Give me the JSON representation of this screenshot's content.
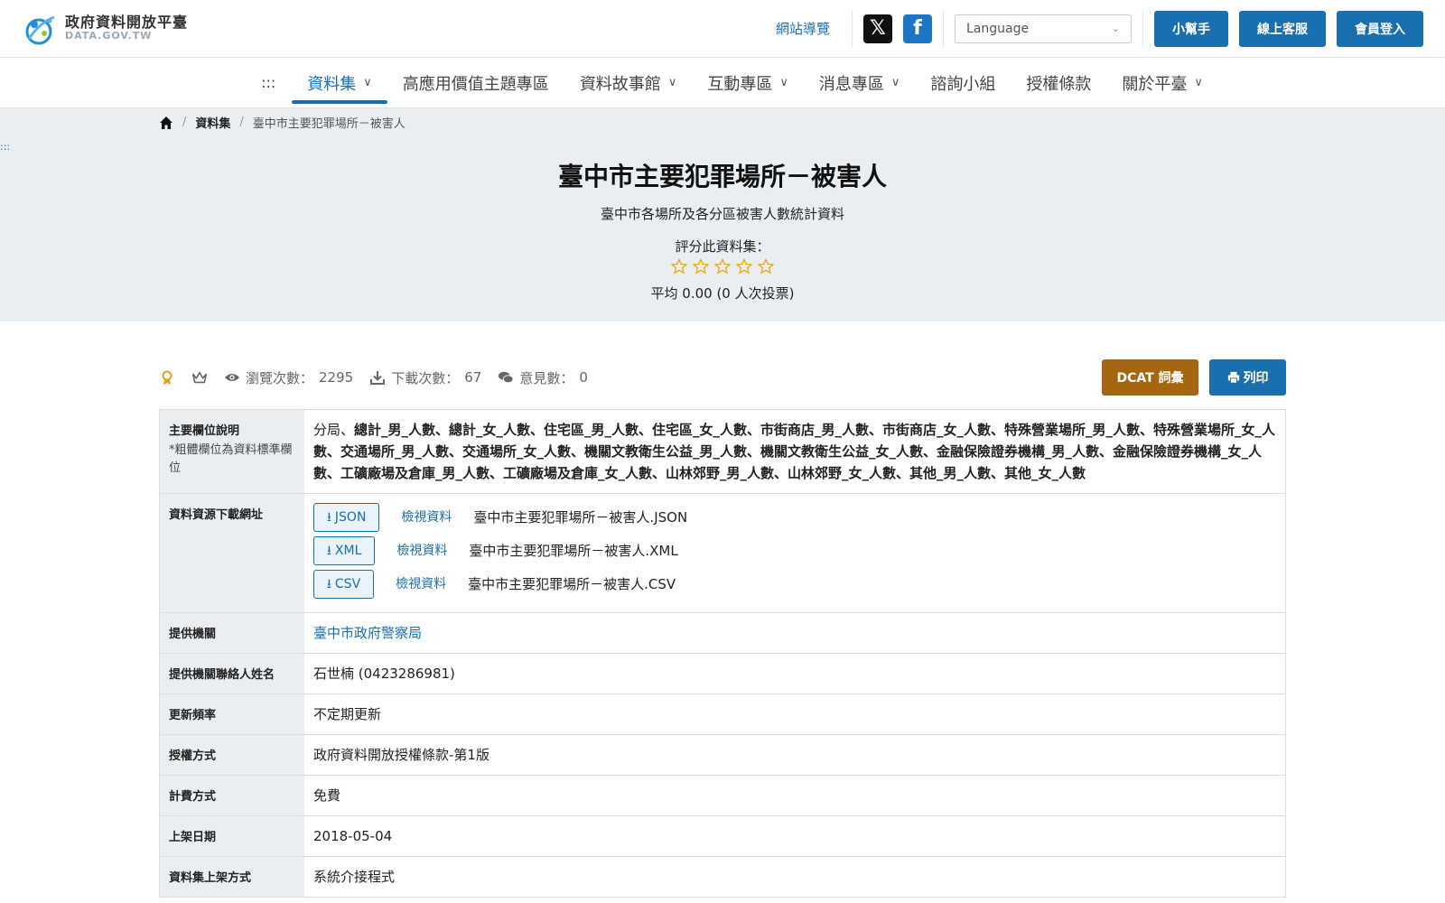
{
  "header": {
    "logo_title": "政府資料開放平臺",
    "logo_sub": "DATA.GOV.TW",
    "sitemap": "網站導覽",
    "x_icon": "x-icon",
    "facebook_icon": "facebook-icon",
    "language_placeholder": "Language",
    "helper": "小幫手",
    "service": "線上客服",
    "login": "會員登入"
  },
  "nav": {
    "dots": ":::",
    "items": [
      {
        "label": "資料集",
        "dropdown": true
      },
      {
        "label": "高應用價值主題專區"
      },
      {
        "label": "資料故事館",
        "dropdown": true
      },
      {
        "label": "互動專區",
        "dropdown": true
      },
      {
        "label": "消息專區",
        "dropdown": true
      },
      {
        "label": "諮詢小組"
      },
      {
        "label": "授權條款"
      },
      {
        "label": "關於平臺",
        "dropdown": true
      }
    ]
  },
  "breadcrumb": {
    "home_icon": "home-icon",
    "sep": "/",
    "level1": "資料集",
    "level2": "臺中市主要犯罪場所－被害人"
  },
  "skip_dots": ":::",
  "dataset": {
    "title": "臺中市主要犯罪場所－被害人",
    "description": "臺中市各場所及各分區被害人數統計資料",
    "rate_label": "評分此資料集：",
    "rating": {
      "value": 0,
      "max": 5
    },
    "average_text": "平均 0.00 (0 人次投票)"
  },
  "stats": {
    "views_label": "瀏覽次數：",
    "views": "2295",
    "downloads_label": "下載次數：",
    "downloads": "67",
    "comments_label": "意見數：",
    "comments": "0",
    "dcat": "DCAT 詞彙",
    "print": "列印"
  },
  "table": {
    "fields_header": "主要欄位說明",
    "fields_note": "*粗體欄位為資料標準欄位",
    "fields_plain_first": "分局、",
    "fields_bold": "總計_男_人數、總計_女_人數、住宅區_男_人數、住宅區_女_人數、市街商店_男_人數、市街商店_女_人數、特殊營業場所_男_人數、特殊營業場所_女_人數、交通場所_男_人數、交通場所_女_人數、機關文教衛生公益_男_人數、機關文教衛生公益_女_人數、金融保險證券機構_男_人數、金融保險證券機構_女_人數、工礦廠場及倉庫_男_人數、工礦廠場及倉庫_女_人數、山林郊野_男_人數、山林郊野_女_人數、其他_男_人數、其他_女_人數",
    "download_header": "資料資源下載網址",
    "resources": [
      {
        "format": "JSON",
        "view": "檢視資料",
        "filename": "臺中市主要犯罪場所－被害人.JSON"
      },
      {
        "format": "XML",
        "view": "檢視資料",
        "filename": "臺中市主要犯罪場所－被害人.XML"
      },
      {
        "format": "CSV",
        "view": "檢視資料",
        "filename": "臺中市主要犯罪場所－被害人.CSV"
      }
    ],
    "agency_header": "提供機關",
    "agency": "臺中市政府警察局",
    "contact_header": "提供機關聯絡人姓名",
    "contact": "石世楠 (0423286981)",
    "frequency_header": "更新頻率",
    "frequency": "不定期更新",
    "license_header": "授權方式",
    "license": "政府資料開放授權條款-第1版",
    "fee_header": "計費方式",
    "fee": "免費",
    "published_header": "上架日期",
    "published": "2018-05-04",
    "method_header": "資料集上架方式",
    "method": "系統介接程式"
  },
  "colors": {
    "primary": "#1a6fae",
    "dcat": "#a6660f",
    "hero_bg": "#e9eef2",
    "star": "#f0a500"
  }
}
